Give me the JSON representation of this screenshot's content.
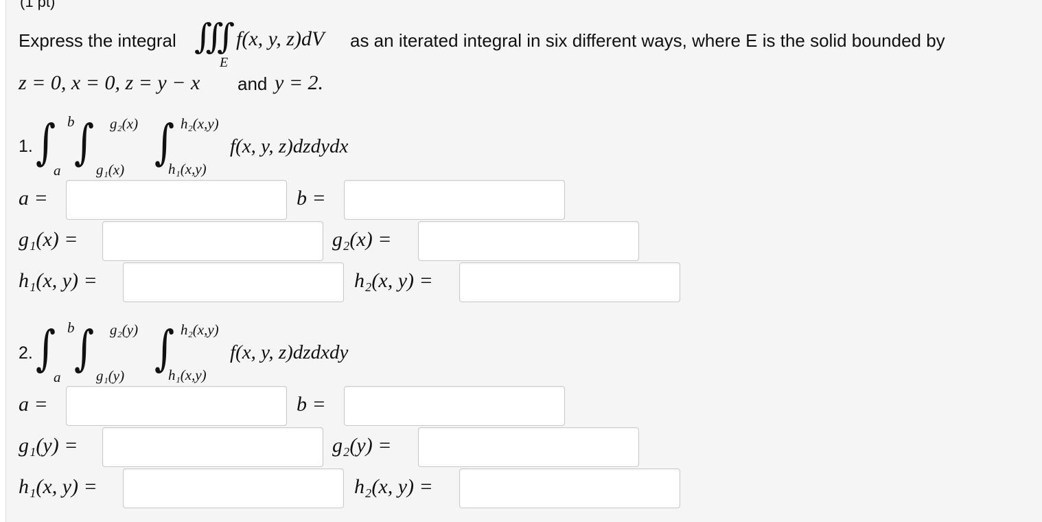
{
  "header": {
    "points": "(1 pt)"
  },
  "prompt": {
    "before": "Express the integral",
    "triple_integral_symbol": "∭",
    "region": "E",
    "integrand": "f(x, y, z)dV",
    "after": "as an iterated integral in six different ways, where E is the solid bounded by",
    "line2_math1": "z = 0, x = 0, z = y − x",
    "line2_and": "and",
    "line2_math2": "y = 2."
  },
  "problems": [
    {
      "number": "1.",
      "outer_upper": "b",
      "outer_lower": "a",
      "middle_upper": "g₂(x)",
      "middle_lower": "g₁(x)",
      "inner_upper": "h₂(x,y)",
      "inner_lower": "h₁(x,y)",
      "integrand": "f(x, y, z)dzdydx",
      "labels": {
        "a": "a =",
        "b": "b =",
        "g1": "g₁(x) =",
        "g2": "g₂(x) =",
        "h1": "h₁(x, y) =",
        "h2": "h₂(x, y) ="
      },
      "values": {
        "a": "",
        "b": "",
        "g1": "",
        "g2": "",
        "h1": "",
        "h2": ""
      }
    },
    {
      "number": "2.",
      "outer_upper": "b",
      "outer_lower": "a",
      "middle_upper": "g₂(y)",
      "middle_lower": "g₁(y)",
      "inner_upper": "h₂(x,y)",
      "inner_lower": "h₁(x,y)",
      "integrand": "f(x, y, z)dzdxdy",
      "labels": {
        "a": "a =",
        "b": "b =",
        "g1": "g₁(y) =",
        "g2": "g₂(y) =",
        "h1": "h₁(x, y) =",
        "h2": "h₂(x, y) ="
      },
      "values": {
        "a": "",
        "b": "",
        "g1": "",
        "g2": "",
        "h1": "",
        "h2": ""
      }
    }
  ]
}
